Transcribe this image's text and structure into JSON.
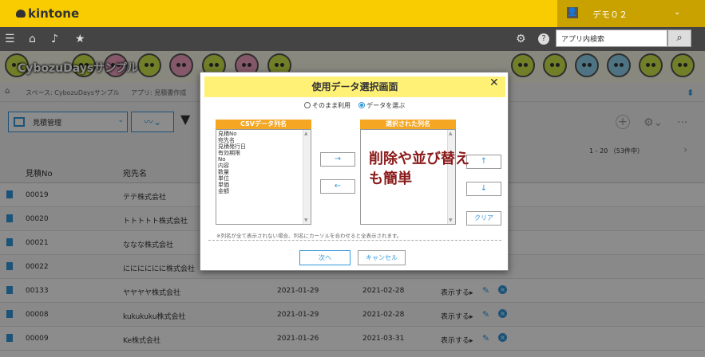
{
  "app": {
    "brand": "kintone"
  },
  "user": {
    "name": "デモ０２"
  },
  "nav": {
    "search_placeholder": "アプリ内検索"
  },
  "space": {
    "name": "CybozuDaysサンプル"
  },
  "breadcrumb": {
    "space": "スペース: CybozuDaysサンプル",
    "app": "アプリ: 見積書作成"
  },
  "toolbar": {
    "view_name": "見積管理"
  },
  "paging": {
    "text": "1 - 20 （53件中）"
  },
  "table": {
    "headers": [
      "見積No",
      "宛先名"
    ],
    "rows": [
      {
        "no": "00019",
        "name": "テテ株式会社",
        "d1": "",
        "d2": "",
        "disp": ""
      },
      {
        "no": "00020",
        "name": "トトトトト株式会社",
        "d1": "",
        "d2": "",
        "disp": ""
      },
      {
        "no": "00021",
        "name": "ななな株式会社",
        "d1": "",
        "d2": "",
        "disp": ""
      },
      {
        "no": "00022",
        "name": "にににににに株式会社",
        "d1": "",
        "d2": "",
        "disp": ""
      },
      {
        "no": "00133",
        "name": "ヤヤヤヤ株式会社",
        "d1": "2021-01-29",
        "d2": "2021-02-28",
        "disp": "表示する▸"
      },
      {
        "no": "00008",
        "name": "kukukuku株式会社",
        "d1": "2021-01-29",
        "d2": "2021-02-28",
        "disp": "表示する▸"
      },
      {
        "no": "00009",
        "name": "Ke株式会社",
        "d1": "2021-01-26",
        "d2": "2021-03-31",
        "disp": "表示する▸"
      }
    ]
  },
  "dialog": {
    "title": "使用データ選択画面",
    "close": "✕",
    "radio_asis": "そのまま利用",
    "radio_select": "データを選ぶ",
    "csv_header": "CSVデータ列名",
    "selected_header": "選択された列名",
    "csv_items": [
      "見積No",
      "宛先名",
      "見積発行日",
      "有効期限",
      "No",
      "内容",
      "数量",
      "単位",
      "単価",
      "金額"
    ],
    "btn_right": "→",
    "btn_left": "←",
    "btn_up": "↑",
    "btn_down": "↓",
    "btn_clear": "クリア",
    "note": "※列名が全て表示されない場合、列名にカーソルを合わせると全表示されます。",
    "ok": "次へ",
    "cancel": "キャンセル"
  },
  "caption": {
    "line1": "削除や並び替え",
    "line2": "も簡単"
  },
  "colors": {
    "topbar": "#f8cc00",
    "accent": "#3498db",
    "list_header": "#f5a623",
    "dialog_title": "#fff176"
  }
}
